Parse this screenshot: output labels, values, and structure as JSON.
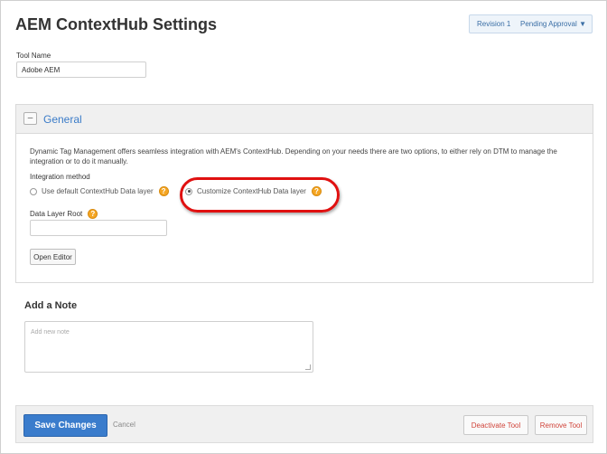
{
  "page": {
    "title": "AEM ContextHub Settings"
  },
  "status": {
    "revision": "Revision 1",
    "state": "Pending Approval",
    "chevron_icon": "chevron-down-icon"
  },
  "tool_name": {
    "label": "Tool Name",
    "value": "Adobe AEM"
  },
  "general": {
    "collapse_symbol": "–",
    "title": "General",
    "description": "Dynamic Tag Management offers seamless integration with AEM's ContextHub. Depending on your needs there are two options, to either rely on DTM to manage the integration or to do it manually.",
    "integration_method_label": "Integration method",
    "options": [
      {
        "label": "Use default ContextHub Data layer",
        "checked": false
      },
      {
        "label": "Customize ContextHub Data layer",
        "checked": true
      }
    ],
    "help_symbol": "?",
    "data_layer_root_label": "Data Layer Root",
    "data_layer_root_value": "",
    "open_editor_label": "Open Editor"
  },
  "note": {
    "title": "Add a Note",
    "placeholder": "Add new note"
  },
  "footer": {
    "save_label": "Save Changes",
    "cancel_label": "Cancel",
    "deactivate_label": "Deactivate Tool",
    "remove_label": "Remove Tool"
  },
  "colors": {
    "accent": "#3a7ccc",
    "highlight": "#e01010",
    "help": "#f5a623",
    "danger_text": "#d0443a"
  }
}
